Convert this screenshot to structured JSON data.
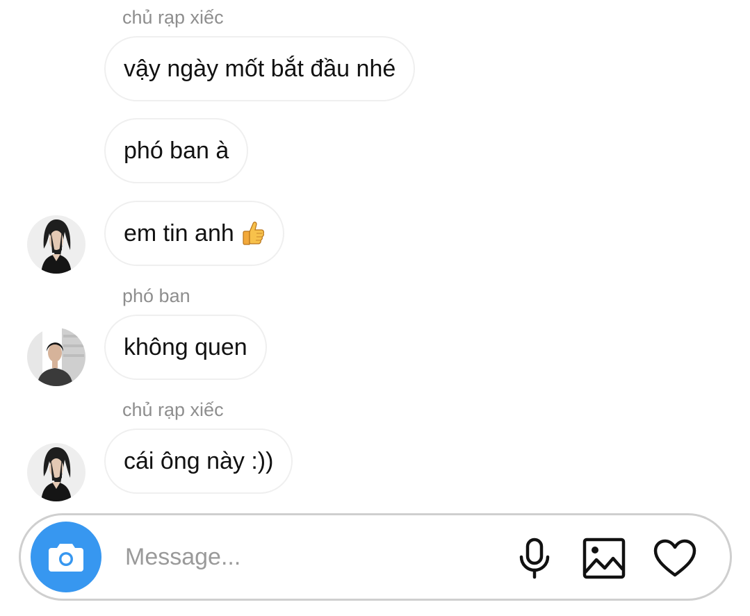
{
  "messages": [
    {
      "sender_label": "chủ rạp xiếc",
      "text": "vậy ngày mốt bắt đầu nhé"
    },
    {
      "text": "phó ban à"
    },
    {
      "text": "em tin anh",
      "emoji": "thumbs-up"
    },
    {
      "sender_label": "phó ban",
      "text": "không quen"
    },
    {
      "sender_label": "chủ rạp xiếc",
      "text": "cái ông này :))"
    }
  ],
  "composer": {
    "placeholder": "Message...",
    "value": "",
    "camera_icon": "camera-icon",
    "mic_icon": "microphone-icon",
    "gallery_icon": "image-icon",
    "like_icon": "heart-icon"
  },
  "colors": {
    "accent": "#3797f0",
    "sender_label": "#8e8e8e",
    "bubble_border": "#efefef",
    "composer_border": "#cfcfcf"
  }
}
